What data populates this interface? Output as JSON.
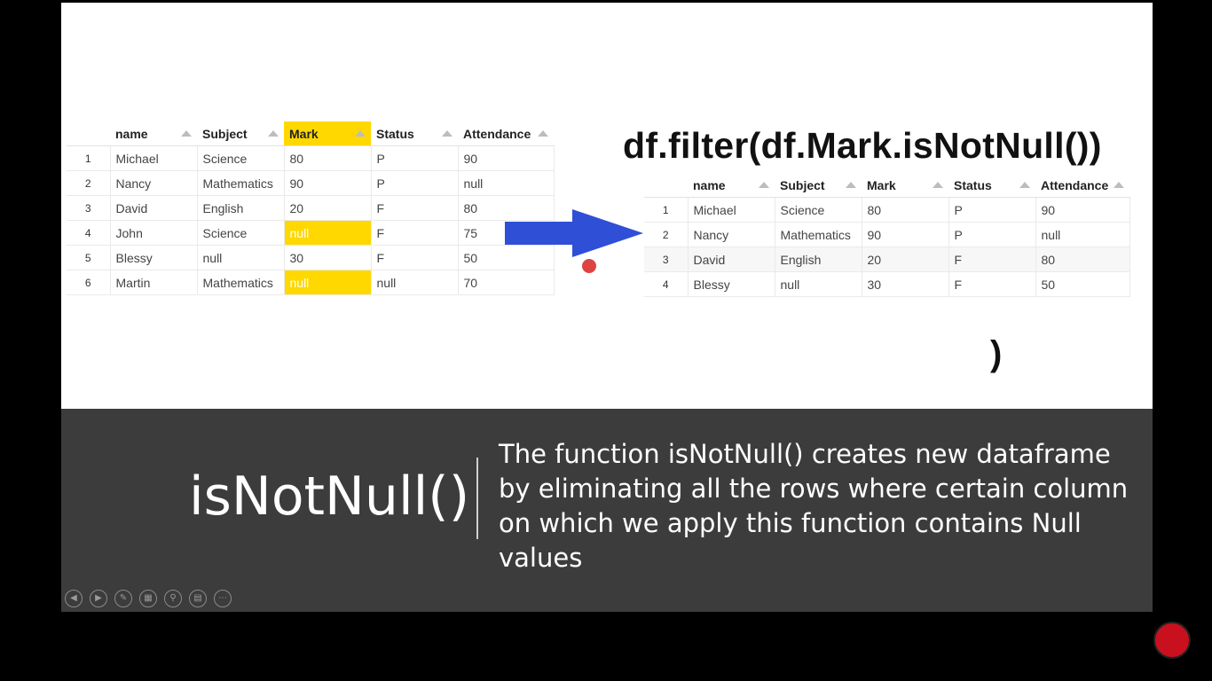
{
  "left_table": {
    "headers": [
      "name",
      "Subject",
      "Mark",
      "Status",
      "Attendance"
    ],
    "rows": [
      {
        "idx": "1",
        "cells": [
          "Michael",
          "Science",
          "80",
          "P",
          "90"
        ]
      },
      {
        "idx": "2",
        "cells": [
          "Nancy",
          "Mathematics",
          "90",
          "P",
          "null"
        ]
      },
      {
        "idx": "3",
        "cells": [
          "David",
          "English",
          "20",
          "F",
          "80"
        ]
      },
      {
        "idx": "4",
        "cells": [
          "John",
          "Science",
          "null",
          "F",
          "75"
        ]
      },
      {
        "idx": "5",
        "cells": [
          "Blessy",
          "null",
          "30",
          "F",
          "50"
        ]
      },
      {
        "idx": "6",
        "cells": [
          "Martin",
          "Mathematics",
          "null",
          "null",
          "70"
        ]
      }
    ],
    "highlight_color": "#ffd800"
  },
  "code_text": "df.filter(df.Mark.isNotNull())",
  "right_table": {
    "headers": [
      "name",
      "Subject",
      "Mark",
      "Status",
      "Attendance"
    ],
    "rows": [
      {
        "idx": "1",
        "cells": [
          "Michael",
          "Science",
          "80",
          "P",
          "90"
        ]
      },
      {
        "idx": "2",
        "cells": [
          "Nancy",
          "Mathematics",
          "90",
          "P",
          "null"
        ]
      },
      {
        "idx": "3",
        "cells": [
          "David",
          "English",
          "20",
          "F",
          "80"
        ]
      },
      {
        "idx": "4",
        "cells": [
          "Blessy",
          "null",
          "30",
          "F",
          "50"
        ]
      }
    ]
  },
  "stray_text": ")",
  "caption": {
    "title": "isNotNull()",
    "description": "The function isNotNull()  creates new dataframe by eliminating all the rows where certain column on which we apply this function contains Null values"
  },
  "arrow_color": "#2f4fd6",
  "band_color": "#3c3c3c",
  "controls": [
    "prev-icon",
    "next-icon",
    "pen-icon",
    "slides-icon",
    "zoom-icon",
    "subtitles-icon",
    "more-icon"
  ]
}
